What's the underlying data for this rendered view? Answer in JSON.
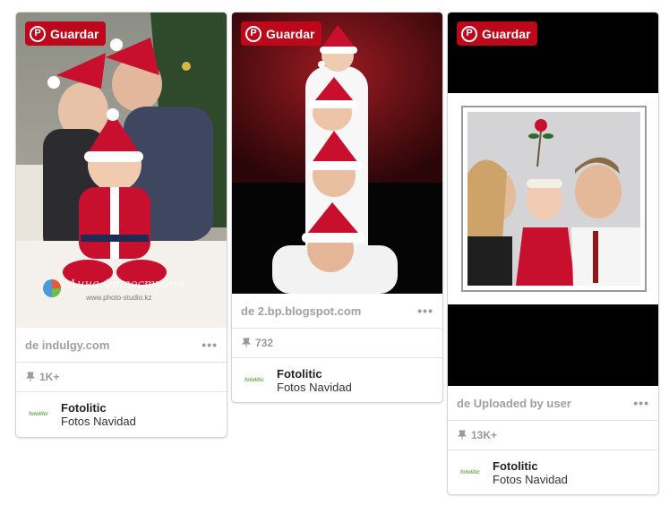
{
  "save_label": "Guardar",
  "pins": [
    {
      "source": "de indulgy.com",
      "repins": "1K+",
      "pinner": "Fotolitic",
      "board": "Fotos Navidad",
      "board_thumb": "fotolitic",
      "watermark_line1": "Анна Фотостудия",
      "watermark_line2": "www.photo-studio.kz"
    },
    {
      "source": "de 2.bp.blogspot.com",
      "repins": "732",
      "pinner": "Fotolitic",
      "board": "Fotos Navidad",
      "board_thumb": "fotolitic"
    },
    {
      "source": "de Uploaded by user",
      "repins": "13K+",
      "pinner": "Fotolitic",
      "board": "Fotos Navidad",
      "board_thumb": "fotolitic"
    }
  ],
  "more_glyph": "•••",
  "colors": {
    "brand_red": "#bd081c",
    "santa_red": "#c8102e"
  }
}
